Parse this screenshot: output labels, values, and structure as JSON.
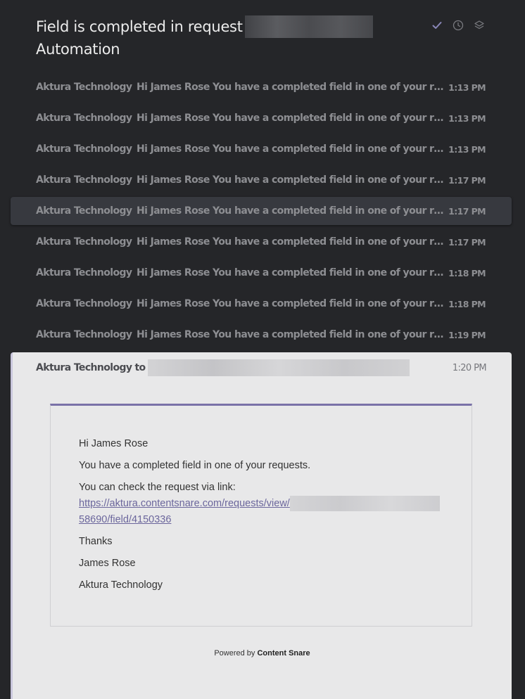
{
  "thread": {
    "subject_line1": "Field is completed in request",
    "subject_line2": "Automation",
    "actions": [
      {
        "icon": "check-icon",
        "label": "Mark as done"
      },
      {
        "icon": "clock-icon",
        "label": "Remind me"
      },
      {
        "icon": "layers-icon",
        "label": "Move"
      }
    ]
  },
  "messages": [
    {
      "sender": "Aktura Technology",
      "preview": "Hi James Rose You have a completed field in one of your requests. You can check the request via link",
      "time": "1:13 PM",
      "selected": false
    },
    {
      "sender": "Aktura Technology",
      "preview": "Hi James Rose You have a completed field in one of your requests. You can check the request via link",
      "time": "1:13 PM",
      "selected": false
    },
    {
      "sender": "Aktura Technology",
      "preview": "Hi James Rose You have a completed field in one of your requests. You can check the request via link",
      "time": "1:13 PM",
      "selected": false
    },
    {
      "sender": "Aktura Technology",
      "preview": "Hi James Rose You have a completed field in one of your requests. You can check the request via link",
      "time": "1:17 PM",
      "selected": false
    },
    {
      "sender": "Aktura Technology",
      "preview": "Hi James Rose You have a completed field in one of your requests. You can check the request via link",
      "time": "1:17 PM",
      "selected": true
    },
    {
      "sender": "Aktura Technology",
      "preview": "Hi James Rose You have a completed field in one of your requests. You can check the request via link",
      "time": "1:17 PM",
      "selected": false
    },
    {
      "sender": "Aktura Technology",
      "preview": "Hi James Rose You have a completed field in one of your requests. You can check the request via link",
      "time": "1:18 PM",
      "selected": false
    },
    {
      "sender": "Aktura Technology",
      "preview": "Hi James Rose You have a completed field in one of your requests. You can check the request via link",
      "time": "1:18 PM",
      "selected": false
    },
    {
      "sender": "Aktura Technology",
      "preview": "Hi James Rose You have a completed field in one of your requests. You can check the request via link",
      "time": "1:19 PM",
      "selected": false
    }
  ],
  "open_message": {
    "from": "Aktura Technology",
    "to_label": "to",
    "time": "1:20 PM",
    "body": {
      "greeting": "Hi James Rose",
      "line1": "You have a completed field in one of your requests.",
      "line2": "You can check the request via link:",
      "link_part1": "https://aktura.contentsnare.com/requests/view/",
      "link_part2": "58690/field/4150336",
      "thanks": "Thanks",
      "signature_name": "James Rose",
      "signature_company": "Aktura Technology"
    },
    "powered_prefix": "Powered by",
    "powered_brand": "Content Snare"
  },
  "colors": {
    "background": "#252629",
    "accent": "#7a72a8",
    "link": "#6b669c"
  }
}
